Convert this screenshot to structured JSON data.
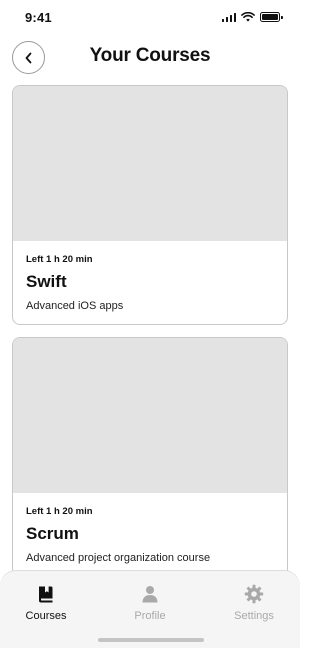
{
  "status_bar": {
    "time": "9:41"
  },
  "header": {
    "title": "Your Courses"
  },
  "courses": [
    {
      "time_left": "Left 1 h 20 min",
      "title": "Swift",
      "description": "Advanced iOS apps"
    },
    {
      "time_left": "Left 1 h 20 min",
      "title": "Scrum",
      "description": "Advanced project organization course"
    }
  ],
  "tab_bar": {
    "items": [
      {
        "label": "Courses",
        "icon": "book-icon",
        "active": true
      },
      {
        "label": "Profile",
        "icon": "person-icon",
        "active": false
      },
      {
        "label": "Settings",
        "icon": "gear-icon",
        "active": false
      }
    ]
  },
  "colors": {
    "active_tab": "#111111",
    "inactive_tab": "#a9a9a9",
    "placeholder": "#e3e3e3"
  }
}
